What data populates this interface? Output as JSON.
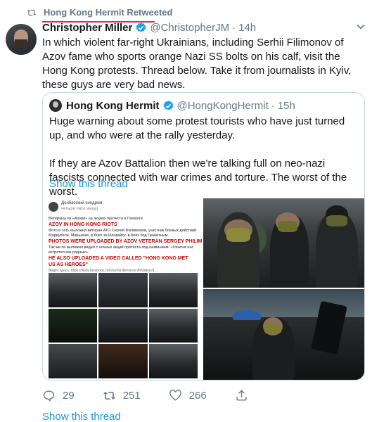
{
  "retweet": {
    "label": "Hong Kong Hermit Retweeted",
    "icon": "retweet-icon"
  },
  "tweet": {
    "author_name": "Christopher Miller",
    "author_handle": "@ChristopherJM",
    "separator": "·",
    "time": "14h",
    "text": "In which violent far-right Ukrainians, including Serhii Filimonov of Azov fame who sports orange Nazi SS bolts on his calf, visit the Hong Kong protests. Thread below. Take it from journalists in Kyiv, these guys are very bad news."
  },
  "quoted": {
    "author_name": "Hong Kong Hermit",
    "author_handle": "@HongKongHermit",
    "separator": "·",
    "time": "15h",
    "paragraph1": "Huge warning about some protest tourists who have just turned up, and who were at the rally yesterday.",
    "paragraph2": "If they are Azov Battalion then we're talking full on neo-nazi fascists connected with war crimes and torture. The worst of the worst.",
    "show_thread": "Show this thread"
  },
  "screenshot_doc": {
    "channel": "Донбасский синдром,",
    "channel_sub": "четыре часа назад",
    "line1": "Ветераны из «Азова» на акциях протеста в Гонконге.",
    "red1": "AZOV IN HONG KONG RIOTS",
    "line2": "Фото в сеть выложил ветеран АТО Сергей Филимонов, участник боевых действий",
    "line3": "Мариуполе, Марьинке, в боях за Иловайск, в боях под Гранитным.",
    "red2": "PHOTOS WERE UPLOADED BY AZOV VETERAN SERGEY PHILIMONOV",
    "line4": "Так же он выложил видео с ночных акций протеста под названием: «Гонконг нас",
    "line5": "встретил как родных».",
    "red3": "HE ALSO UPLOADED A VIDEO CALLED \"HONG KONG MET US AS HEROES\"",
    "link": "Видео здесь: https://www.facebook.com/serhii.filimonov.98/videos/1..."
  },
  "actions": {
    "reply_count": "29",
    "retweet_count": "251",
    "like_count": "266"
  },
  "show_thread": "Show this thread",
  "colors": {
    "link": "#1b95e0",
    "secondary": "#657786",
    "border": "#ccd6dd",
    "verified": "#1da1f2"
  }
}
